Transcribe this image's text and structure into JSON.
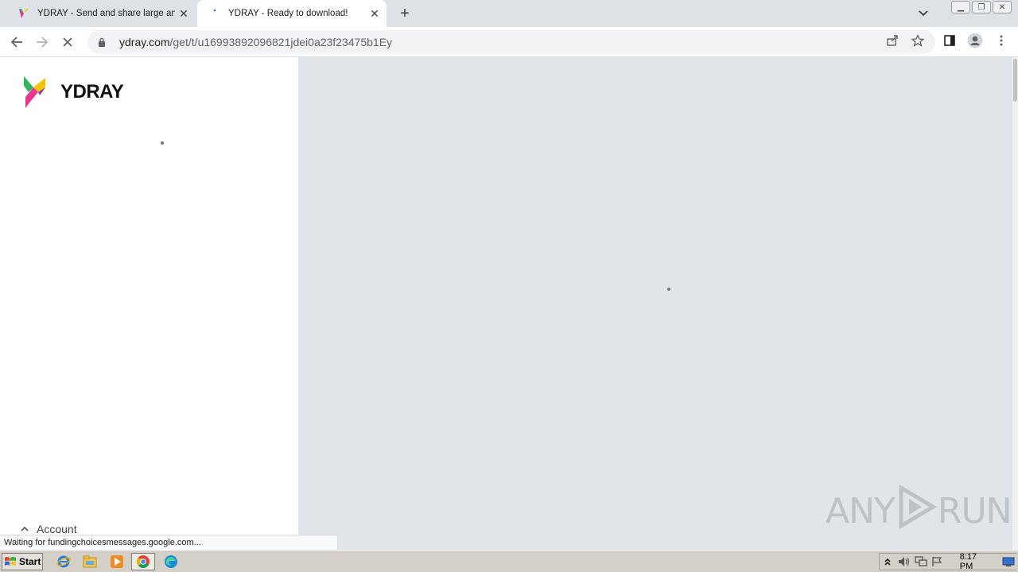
{
  "tabs": [
    {
      "title": "YDRAY - Send and share large and b"
    },
    {
      "title": "YDRAY - Ready to download!"
    }
  ],
  "address_bar": {
    "host": "ydray.com",
    "path": "/get/t/u16993892096821jdei0a23f23475b1Ey"
  },
  "page": {
    "logo_text": "YDRAY",
    "account_label": "Account"
  },
  "status_text": "Waiting for fundingchoicesmessages.google.com...",
  "watermark": {
    "left": "ANY",
    "right": "RUN"
  },
  "taskbar": {
    "start_label": "Start",
    "clock": "8:17 PM"
  },
  "icons": [
    "ydray-favicon",
    "loading-favicon",
    "close-icon",
    "plus-icon",
    "chevron-down-icon",
    "back-arrow-icon",
    "forward-arrow-icon",
    "stop-loading-icon",
    "lock-icon",
    "share-icon",
    "star-icon",
    "side-panel-icon",
    "profile-icon",
    "menu-dots-icon",
    "windows-flag-icon",
    "ie-icon",
    "explorer-icon",
    "media-player-icon",
    "chrome-icon",
    "edge-icon",
    "volume-icon",
    "network-icon",
    "flag-icon",
    "show-desktop-icon"
  ],
  "colors": {
    "brand_pink": "#e8368f",
    "brand_yellow": "#f5c400",
    "brand_green": "#2fb457",
    "brand_purple": "#7b3fa0",
    "panel_gray": "#e1e4e9"
  }
}
